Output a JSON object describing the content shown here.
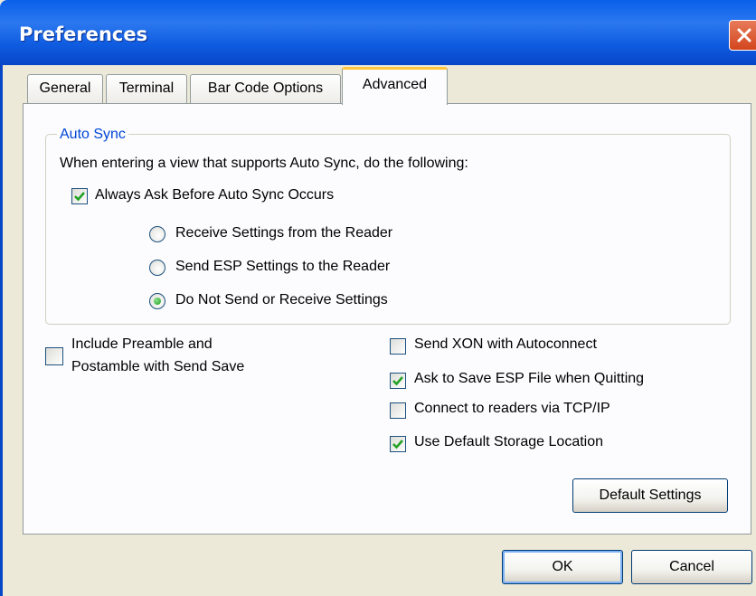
{
  "window": {
    "title": "Preferences",
    "close_icon": "close-icon"
  },
  "tabs": [
    {
      "label": "General",
      "active": false
    },
    {
      "label": "Terminal",
      "active": false
    },
    {
      "label": "Bar Code Options",
      "active": false
    },
    {
      "label": "Advanced",
      "active": true
    }
  ],
  "auto_sync": {
    "group_label": "Auto Sync",
    "description": "When entering a view that supports Auto Sync, do the following:",
    "always_ask": {
      "label": "Always Ask Before Auto Sync Occurs",
      "checked": true
    },
    "options": [
      {
        "label": "Receive Settings from the Reader",
        "selected": false
      },
      {
        "label": "Send ESP Settings to the Reader",
        "selected": false
      },
      {
        "label": "Do Not Send or Receive Settings",
        "selected": true
      }
    ]
  },
  "include_preamble": {
    "line1": "Include Preamble and",
    "line2": "Postamble with Send Save",
    "checked": false
  },
  "right_options": [
    {
      "label": "Send XON with Autoconnect",
      "checked": false
    },
    {
      "label": "Ask to Save ESP File when Quitting",
      "checked": true
    },
    {
      "label": "Connect to readers via TCP/IP",
      "checked": false
    },
    {
      "label": "Use Default Storage Location",
      "checked": true
    }
  ],
  "buttons": {
    "default_settings": "Default Settings",
    "ok": "OK",
    "cancel": "Cancel"
  },
  "colors": {
    "title_bar": "#0A5FEA",
    "group_label": "#0046D5",
    "active_tab_accent": "#FFC83C",
    "check_mark": "#21A121"
  }
}
